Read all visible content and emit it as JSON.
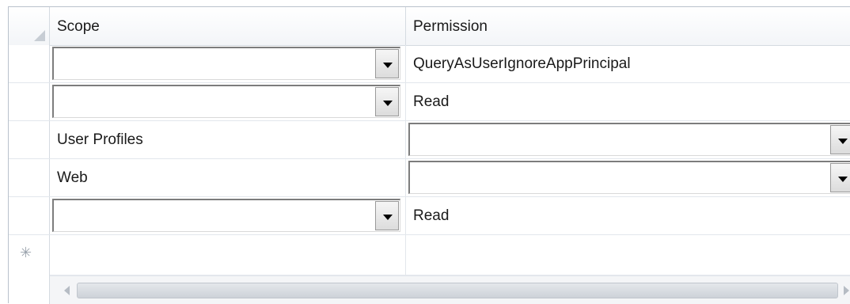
{
  "grid": {
    "columns": [
      "Scope",
      "Permission"
    ],
    "rows": [
      {
        "scope": "",
        "permission": "QueryAsUserIgnoreAppPrincipal"
      },
      {
        "scope": "",
        "permission": "Read"
      },
      {
        "scope": "User Profiles",
        "permission": ""
      },
      {
        "scope": "Web",
        "permission": ""
      },
      {
        "scope": "",
        "permission": "Read"
      }
    ],
    "new_row_icon": "new-row-asterisk-icon"
  }
}
